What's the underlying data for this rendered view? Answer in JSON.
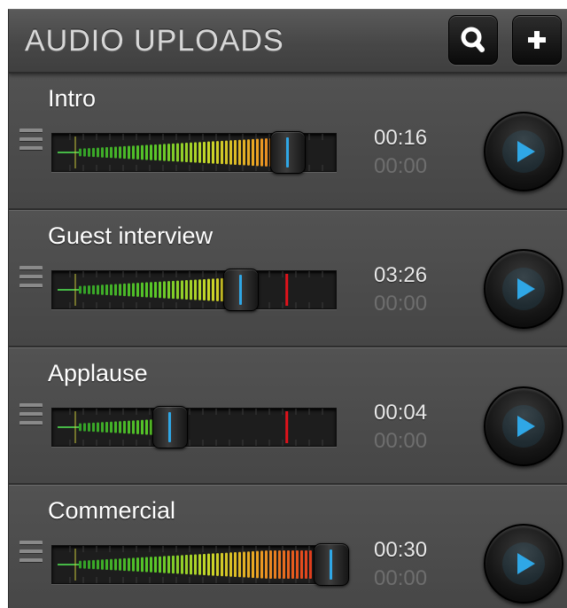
{
  "header": {
    "title": "AUDIO UPLOADS",
    "search_icon": "search-icon",
    "add_icon": "plus-icon"
  },
  "colors": {
    "panel_bg": "#4b4b4b",
    "meter_bg": "#1d1d1d",
    "accent_blue": "#2fa7e6",
    "limit_marker": "#e0121b",
    "text": "#ffffff",
    "time_inactive": "#6e6e6e"
  },
  "tracks": [
    {
      "name": "Intro",
      "duration": "00:16",
      "position": "00:00",
      "level": 0.84,
      "marker": null,
      "play_icon": "play-icon"
    },
    {
      "name": "Guest interview",
      "duration": "03:26",
      "position": "00:00",
      "level": 0.67,
      "marker": 0.84,
      "play_icon": "play-icon"
    },
    {
      "name": "Applause",
      "duration": "00:04",
      "position": "00:00",
      "level": 0.41,
      "marker": 0.84,
      "play_icon": "play-icon"
    },
    {
      "name": "Commercial",
      "duration": "00:30",
      "position": "00:00",
      "level": 1.0,
      "marker": null,
      "play_icon": "play-icon"
    }
  ]
}
